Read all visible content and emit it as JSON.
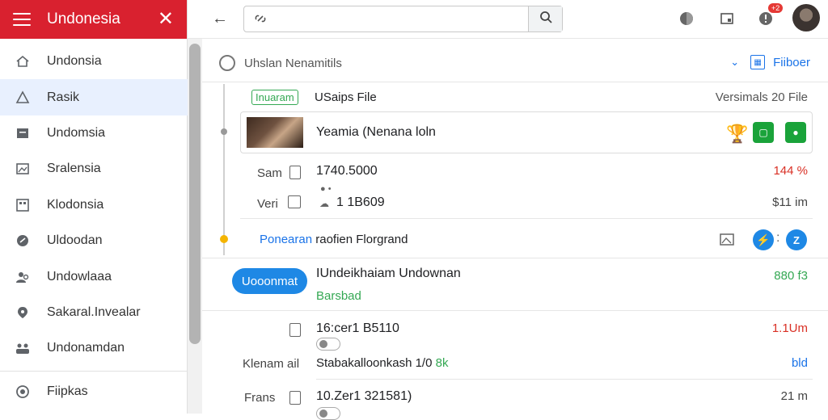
{
  "sidebar": {
    "title": "Undonesia",
    "items": [
      {
        "label": "Undonsia",
        "icon": "home-icon"
      },
      {
        "label": "Rasik",
        "icon": "alert-icon",
        "active": true
      },
      {
        "label": "Undomsia",
        "icon": "inbox-icon"
      },
      {
        "label": "Sralensia",
        "icon": "image-icon"
      },
      {
        "label": "Klodonsia",
        "icon": "grid-icon"
      },
      {
        "label": "Uldoodan",
        "icon": "link-icon"
      },
      {
        "label": "Undowlaaa",
        "icon": "people-icon"
      },
      {
        "label": "Sakaral.Invealar",
        "icon": "location-icon"
      },
      {
        "label": "Undonamdan",
        "icon": "group-icon"
      }
    ],
    "bottom_item": {
      "label": "Fiipkas",
      "icon": "help-icon"
    }
  },
  "topbar": {
    "search_value": "",
    "badge": "+2"
  },
  "section": {
    "title": "Uhslan Nenamitils",
    "filter_label": "Fiiboer"
  },
  "file": {
    "tag": "Inuaram",
    "title": "USaips File",
    "versions": "Versimals 20 File",
    "card_name": "Yeamia (Nenana loln"
  },
  "rows": [
    {
      "label": "Sam",
      "value": "1740.5000",
      "right": "144 %",
      "right_color": "#d93025"
    },
    {
      "label": "Veri",
      "value": "1 1B609",
      "right": "$11 im",
      "right_color": "#444444"
    }
  ],
  "activity": {
    "blue": "Ponearan",
    "rest": "raofien Florgrand"
  },
  "entry": {
    "pill": "Uooonmat",
    "title": "IUndeikhaiam Undownan",
    "status": "Barsbad",
    "right": "880 f3"
  },
  "entry_rows": [
    {
      "label": "",
      "value": "16:cer1 B5110",
      "right": "1.1Um",
      "right_color": "#d93025"
    },
    {
      "label": "Klenam ail",
      "value": "Stabakalloonkash 1/0",
      "value_suffix": "8k",
      "right": "bld",
      "right_color": "#1a73e8"
    },
    {
      "label": "Frans",
      "value": "10.Zer1 321581)",
      "right": "21 m",
      "right_color": "#444444"
    }
  ],
  "colors": {
    "header_red": "#d9212f",
    "accent_blue": "#1a73e8",
    "green": "#34a853"
  }
}
